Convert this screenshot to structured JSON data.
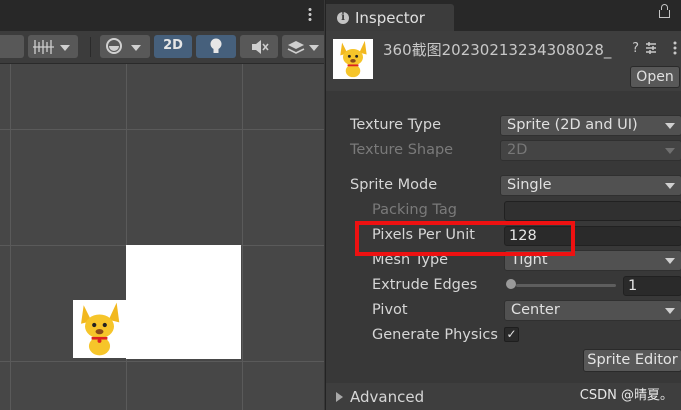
{
  "scene_toolbar": {
    "view_2d_label": "2D"
  },
  "inspector": {
    "tab_label": "Inspector",
    "asset_name": "360截图20230213234308028_",
    "open_label": "Open",
    "fields": {
      "texture_type": {
        "label": "Texture Type",
        "value": "Sprite (2D and UI)"
      },
      "texture_shape": {
        "label": "Texture Shape",
        "value": "2D"
      },
      "sprite_mode": {
        "label": "Sprite Mode",
        "value": "Single"
      },
      "packing_tag": {
        "label": "Packing Tag",
        "value": ""
      },
      "pixels_per_unit": {
        "label": "Pixels Per Unit",
        "value": "128"
      },
      "mesh_type": {
        "label": "Mesh Type",
        "value": "Tight"
      },
      "extrude_edges": {
        "label": "Extrude Edges",
        "value": "1"
      },
      "pivot": {
        "label": "Pivot",
        "value": "Center"
      },
      "generate_physics": {
        "label": "Generate Physics Shape",
        "checked": true
      }
    },
    "sprite_editor_label": "Sprite Editor",
    "advanced_label": "Advanced"
  },
  "watermark": "CSDN @晴夏。",
  "colors": {
    "highlight_box": "#ee1111",
    "toolbar_blue": "#46607c"
  }
}
